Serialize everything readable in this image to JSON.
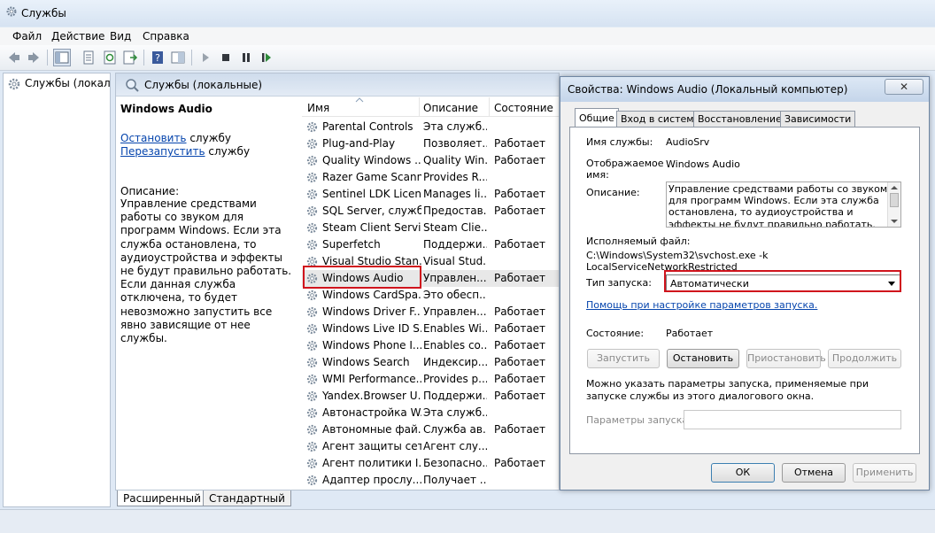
{
  "window": {
    "title": "Службы"
  },
  "menu": {
    "items": [
      "Файл",
      "Действие",
      "Вид",
      "Справка"
    ]
  },
  "tree": {
    "item_label": "Службы (локалы"
  },
  "services_pane": {
    "header": "Службы (локальные)",
    "selected_name": "Windows Audio",
    "stop_link": "Остановить",
    "stop_suffix": " службу",
    "restart_link": "Перезапустить",
    "restart_suffix": " службу",
    "description_label": "Описание:",
    "description_text": "Управление средствами работы со звуком для программ Windows. Если эта служба остановлена, то аудиоустройства и эффекты не будут правильно работать. Если данная служба отключена, то будет невозможно запустить все явно зависящие от нее службы."
  },
  "list": {
    "columns": {
      "name": "Имя",
      "description": "Описание",
      "state": "Состояние"
    },
    "rows": [
      {
        "name": "Parental Controls",
        "description": "Эта служб...",
        "state": ""
      },
      {
        "name": "Plug-and-Play",
        "description": "Позволяет...",
        "state": "Работает"
      },
      {
        "name": "Quality Windows ...",
        "description": "Quality Win...",
        "state": "Работает"
      },
      {
        "name": "Razer Game Scann...",
        "description": "Provides R...",
        "state": ""
      },
      {
        "name": "Sentinel LDK Licen...",
        "description": "Manages li...",
        "state": "Работает"
      },
      {
        "name": "SQL Server, служб...",
        "description": "Предостав...",
        "state": "Работает"
      },
      {
        "name": "Steam Client Servi...",
        "description": "Steam Clie...",
        "state": ""
      },
      {
        "name": "Superfetch",
        "description": "Поддержи...",
        "state": "Работает"
      },
      {
        "name": "Visual Studio Stan...",
        "description": "Visual Stud...",
        "state": ""
      },
      {
        "name": "Windows Audio",
        "description": "Управлен...",
        "state": "Работает"
      },
      {
        "name": "Windows CardSpa...",
        "description": "Это обесп...",
        "state": ""
      },
      {
        "name": "Windows Driver F...",
        "description": "Управлен...",
        "state": "Работает"
      },
      {
        "name": "Windows Live ID S...",
        "description": "Enables Wi...",
        "state": "Работает"
      },
      {
        "name": "Windows Phone I...",
        "description": "Enables co...",
        "state": "Работает"
      },
      {
        "name": "Windows Search",
        "description": "Индексир...",
        "state": "Работает"
      },
      {
        "name": "WMI Performance...",
        "description": "Provides p...",
        "state": "Работает"
      },
      {
        "name": "Yandex.Browser U...",
        "description": "Поддержи...",
        "state": "Работает"
      },
      {
        "name": "Автонастройка W...",
        "description": "Эта служб...",
        "state": ""
      },
      {
        "name": "Автономные фай...",
        "description": "Служба ав...",
        "state": "Работает"
      },
      {
        "name": "Агент защиты сет...",
        "description": "Агент слу...",
        "state": ""
      },
      {
        "name": "Агент политики I...",
        "description": "Безопасно...",
        "state": "Работает"
      },
      {
        "name": "Адаптер прослу...",
        "description": "Получает ...",
        "state": ""
      }
    ]
  },
  "view_tabs": [
    "Расширенный",
    "Стандартный"
  ],
  "dialog": {
    "title": "Свойства: Windows Audio (Локальный компьютер)",
    "close_label": "✕",
    "tabs": [
      "Общие",
      "Вход в систему",
      "Восстановление",
      "Зависимости"
    ],
    "service_name_label": "Имя службы:",
    "service_name_value": "AudioSrv",
    "display_name_label_1": "Отображаемое",
    "display_name_label_2": "имя:",
    "display_name_value": "Windows Audio",
    "description_label": "Описание:",
    "description_value": "Управление средствами работы со звуком для программ Windows. Если эта служба остановлена, то аудиоустройства и эффекты не будут правильно работать. Если данная служба",
    "executable_label": "Исполняемый файл:",
    "executable_value": "C:\\Windows\\System32\\svchost.exe -k LocalServiceNetworkRestricted",
    "startup_type_label": "Тип запуска:",
    "startup_type_value": "Автоматически",
    "help_link": "Помощь при настройке параметров запуска.",
    "state_label": "Состояние:",
    "state_value": "Работает",
    "buttons": {
      "start": "Запустить",
      "stop": "Остановить",
      "pause": "Приостановить",
      "resume": "Продолжить"
    },
    "params_hint": "Можно указать параметры запуска, применяемые при запуске службы из этого диалогового окна.",
    "params_label": "Параметры запуска:",
    "ok": "ОК",
    "cancel": "Отмена",
    "apply": "Применить"
  }
}
